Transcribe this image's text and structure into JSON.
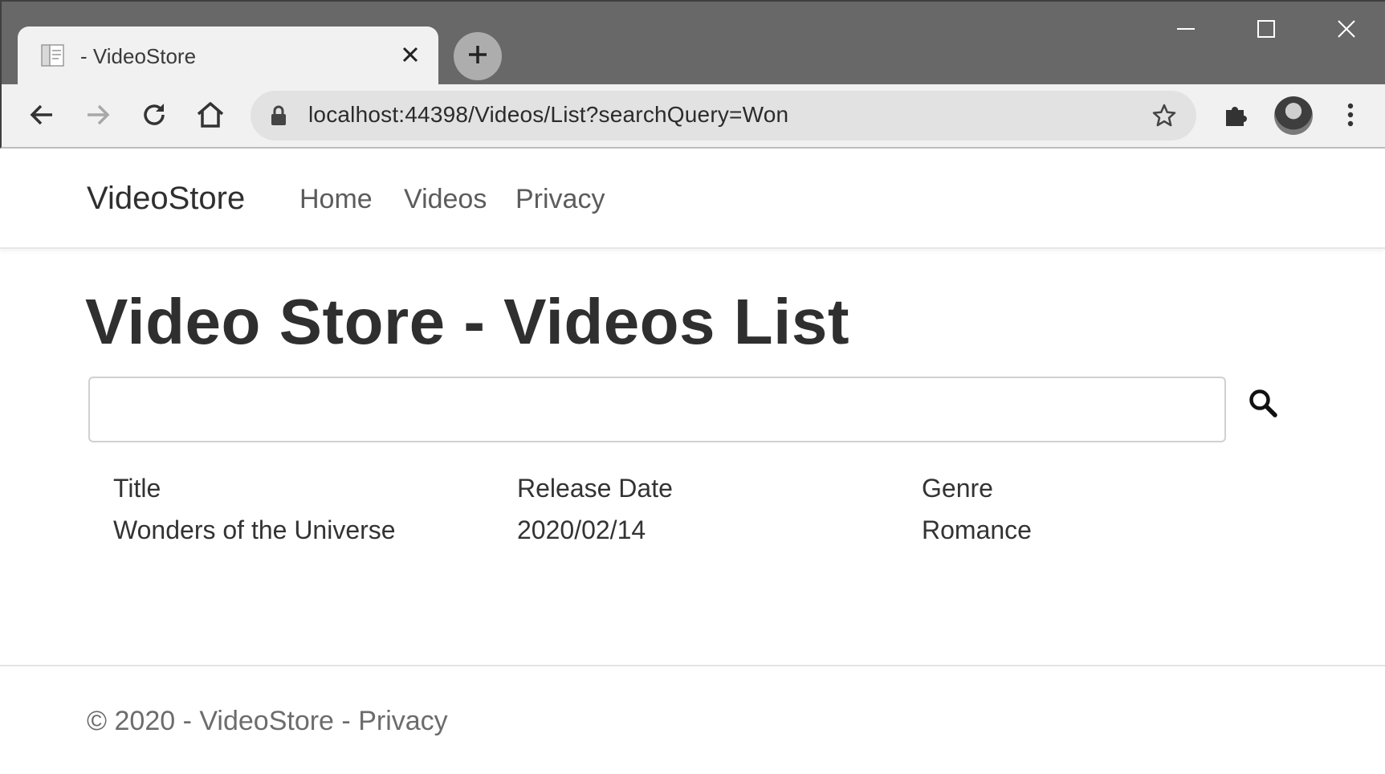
{
  "browser": {
    "tab": {
      "title": "- VideoStore"
    },
    "address_bar": {
      "url": "localhost:44398/Videos/List?searchQuery=Won"
    },
    "window_controls": [
      "minimize",
      "maximize",
      "close"
    ],
    "colors": {
      "titlebar": "#686868",
      "toolbar": "#f1f1f1",
      "omnibox": "#e2e2e2"
    }
  },
  "site": {
    "brand": "VideoStore",
    "nav": [
      {
        "label": "Home"
      },
      {
        "label": "Videos"
      },
      {
        "label": "Privacy"
      }
    ]
  },
  "main": {
    "title": "Video Store - Videos List",
    "search": {
      "value": "",
      "placeholder": ""
    },
    "table": {
      "headers": [
        "Title",
        "Release Date",
        "Genre"
      ],
      "rows": [
        [
          "Wonders of the Universe",
          "2020/02/14",
          "Romance"
        ]
      ]
    }
  },
  "footer": {
    "prefix": "© 2020 - VideoStore - ",
    "privacy_link": "Privacy"
  },
  "icons": {
    "tab_favicon": "page-icon",
    "tab_close": "close-icon",
    "new_tab": "plus-icon",
    "back": "arrow-left-icon",
    "forward": "arrow-right-icon",
    "reload": "reload-icon",
    "home": "home-icon",
    "lock": "lock-icon",
    "bookmark": "star-icon",
    "extensions": "puzzle-icon",
    "menu": "kebab-menu-icon",
    "search": "magnifier-icon"
  }
}
